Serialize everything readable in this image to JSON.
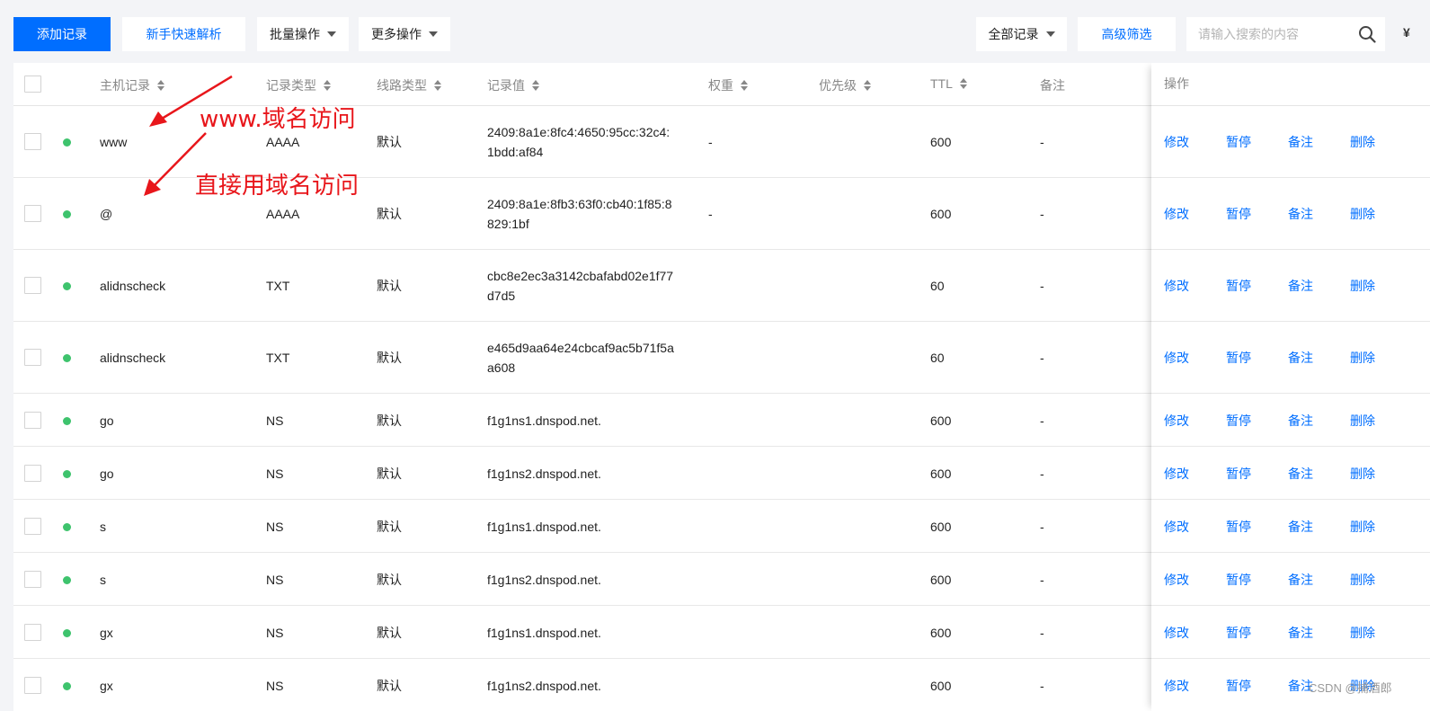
{
  "toolbar": {
    "add_record": "添加记录",
    "quick_guide": "新手快速解析",
    "batch_ops": "批量操作",
    "more_ops": "更多操作",
    "all_records": "全部记录",
    "advanced_filter": "高级筛选",
    "search_placeholder": "请输入搜索的内容",
    "edge_glyph": "¥"
  },
  "table": {
    "columns": {
      "host": "主机记录",
      "type": "记录类型",
      "line": "线路类型",
      "value": "记录值",
      "weight": "权重",
      "priority": "优先级",
      "ttl": "TTL",
      "remark": "备注",
      "ops": "操作"
    },
    "actions": {
      "edit": "修改",
      "pause": "暂停",
      "note": "备注",
      "delete": "删除"
    },
    "rows": [
      {
        "host": "www",
        "type": "AAAA",
        "line": "默认",
        "value": "2409:8a1e:8fc4:4650:95cc:32c4:",
        "value2": "1bdd:af84",
        "weight": "-",
        "ttl": "600",
        "remark": "-"
      },
      {
        "host": "@",
        "type": "AAAA",
        "line": "默认",
        "value": "2409:8a1e:8fb3:63f0:cb40:1f85:8",
        "value2": "829:1bf",
        "weight": "-",
        "ttl": "600",
        "remark": "-"
      },
      {
        "host": "alidnscheck",
        "type": "TXT",
        "line": "默认",
        "value": "cbc8e2ec3a3142cbafabd02e1f77",
        "value2": "d7d5",
        "weight": "",
        "ttl": "60",
        "remark": "-"
      },
      {
        "host": "alidnscheck",
        "type": "TXT",
        "line": "默认",
        "value": "e465d9aa64e24cbcaf9ac5b71f5a",
        "value2": "a608",
        "weight": "",
        "ttl": "60",
        "remark": "-"
      },
      {
        "host": "go",
        "type": "NS",
        "line": "默认",
        "value": "f1g1ns1.dnspod.net.",
        "value2": "",
        "weight": "",
        "ttl": "600",
        "remark": "-"
      },
      {
        "host": "go",
        "type": "NS",
        "line": "默认",
        "value": "f1g1ns2.dnspod.net.",
        "value2": "",
        "weight": "",
        "ttl": "600",
        "remark": "-"
      },
      {
        "host": "s",
        "type": "NS",
        "line": "默认",
        "value": "f1g1ns1.dnspod.net.",
        "value2": "",
        "weight": "",
        "ttl": "600",
        "remark": "-"
      },
      {
        "host": "s",
        "type": "NS",
        "line": "默认",
        "value": "f1g1ns2.dnspod.net.",
        "value2": "",
        "weight": "",
        "ttl": "600",
        "remark": "-"
      },
      {
        "host": "gx",
        "type": "NS",
        "line": "默认",
        "value": "f1g1ns1.dnspod.net.",
        "value2": "",
        "weight": "",
        "ttl": "600",
        "remark": "-"
      },
      {
        "host": "gx",
        "type": "NS",
        "line": "默认",
        "value": "f1g1ns2.dnspod.net.",
        "value2": "",
        "weight": "",
        "ttl": "600",
        "remark": "-"
      }
    ]
  },
  "annotations": {
    "first": "www.域名访问",
    "second": "直接用域名访问"
  },
  "watermark": "CSDN @捕酒郎",
  "colors": {
    "primary": "#006eff",
    "status_active": "#3ec36d",
    "annotation": "#e8161b"
  }
}
